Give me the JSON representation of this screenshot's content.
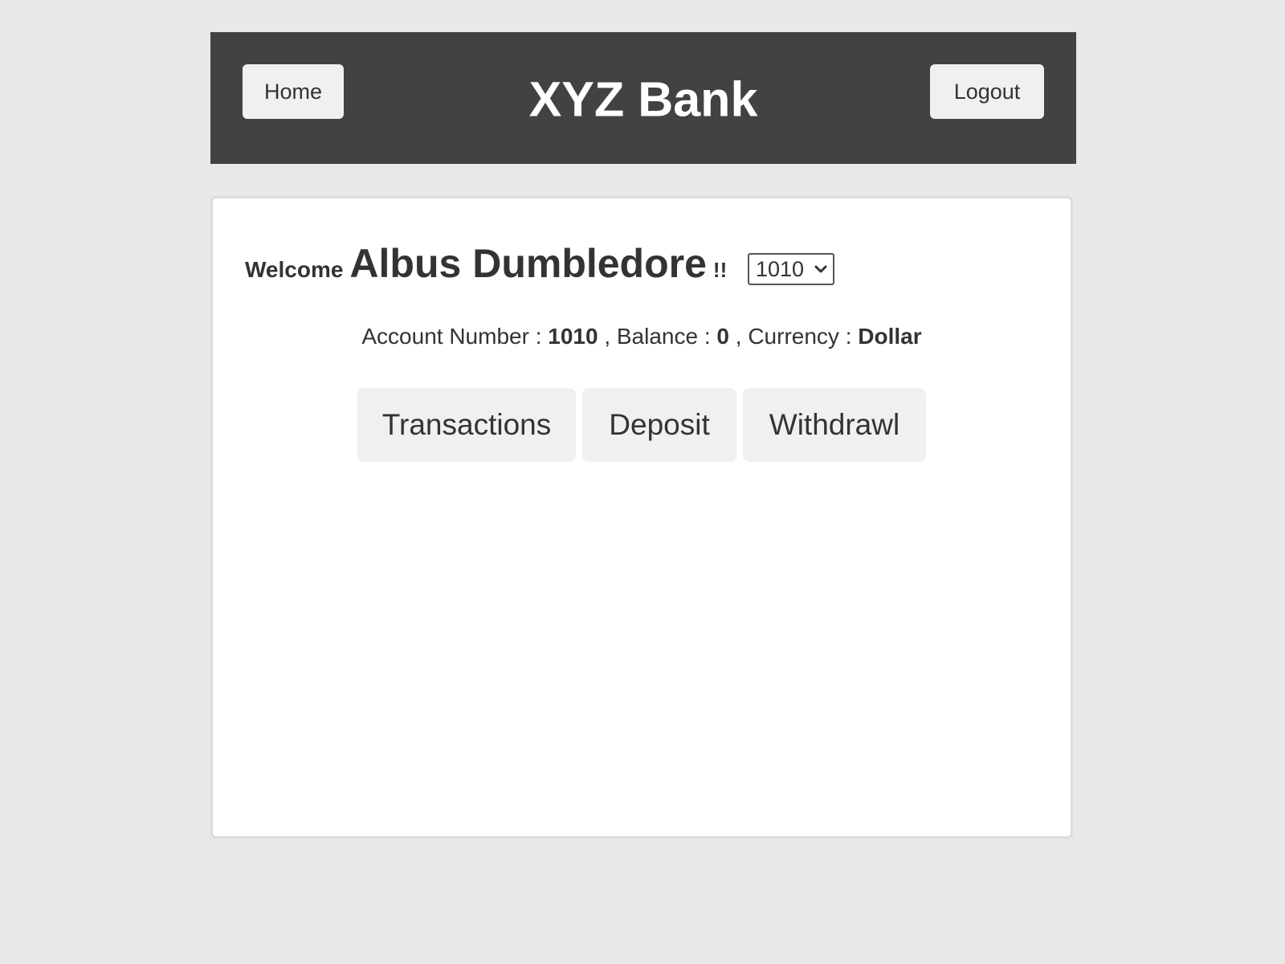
{
  "header": {
    "title": "XYZ Bank",
    "home_label": "Home",
    "logout_label": "Logout"
  },
  "welcome": {
    "greeting": "Welcome",
    "customer_name": "Albus Dumbledore",
    "suffix": "!!"
  },
  "account_select": {
    "selected": "1010"
  },
  "account_info": {
    "account_number_label": "Account Number : ",
    "account_number": "1010",
    "balance_label": " , Balance : ",
    "balance": "0",
    "currency_label": " , Currency : ",
    "currency": "Dollar"
  },
  "actions": {
    "transactions_label": "Transactions",
    "deposit_label": "Deposit",
    "withdrawl_label": "Withdrawl"
  },
  "colors": {
    "header_bg": "#424242",
    "page_bg": "#e8e8e8",
    "button_bg": "#f0f0f0",
    "text": "#333333"
  },
  "icons": {
    "select_arrow": "chevron-down-icon"
  }
}
